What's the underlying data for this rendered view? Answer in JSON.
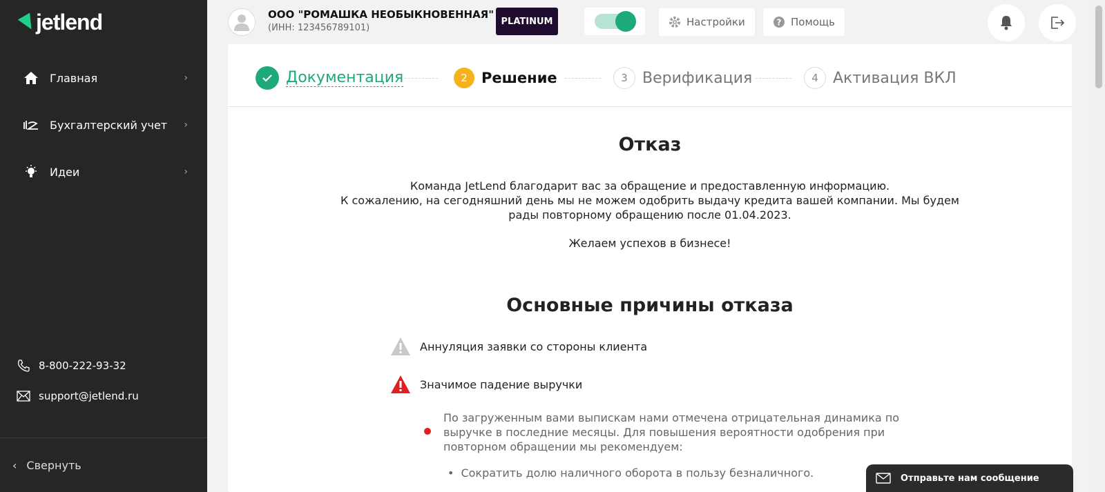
{
  "sidebar": {
    "logo": "jetlend",
    "items": [
      {
        "label": "Главная",
        "icon": "home-icon"
      },
      {
        "label": "Бухгалтерский учет",
        "icon": "accounting-icon"
      },
      {
        "label": "Идеи",
        "icon": "lightbulb-icon"
      }
    ],
    "phone": "8-800-222-93-32",
    "email": "support@jetlend.ru",
    "collapse_label": "Свернуть"
  },
  "header": {
    "company_name": "ООО \"РОМАШКА НЕОБЫКНОВЕННАЯ\"",
    "company_inn": "(ИНН: 123456789101)",
    "badge": "PLATINUM",
    "settings_label": "Настройки",
    "help_label": "Помощь"
  },
  "steps": [
    {
      "num": "",
      "label": "Документация",
      "state": "done"
    },
    {
      "num": "2",
      "label": "Решение",
      "state": "active"
    },
    {
      "num": "3",
      "label": "Верификация",
      "state": "pending"
    },
    {
      "num": "4",
      "label": "Активация ВКЛ",
      "state": "pending"
    }
  ],
  "content": {
    "title": "Отказ",
    "line1": "Команда JetLend благодарит вас за обращение и предоставленную информацию.",
    "line2": "К сожалению, на сегодняшний день мы не можем одобрить выдачу кредита вашей компании. Мы будем рады повторному обращению после 01.04.2023.",
    "wish": "Желаем успехов в бизнесе!",
    "reasons_title": "Основные причины отказа",
    "reason1": "Аннуляция заявки со стороны клиента",
    "reason2": "Значимое падение выручки",
    "detail": "По загруженным вами выпискам нами отмечена отрицательная динамика по выручке в последние месяцы. Для повышения вероятности одобрения при повторном обращении мы рекомендуем:",
    "bullet1": "Сократить долю наличного оборота в пользу безналичного."
  },
  "chat": {
    "label": "Отправьте нам сообщение"
  },
  "colors": {
    "sidebar_bg": "#262626",
    "accent_green": "#1eaa78",
    "step_active": "#f5b21d",
    "danger": "#e02020",
    "badge_bg": "#1e0b2e"
  }
}
